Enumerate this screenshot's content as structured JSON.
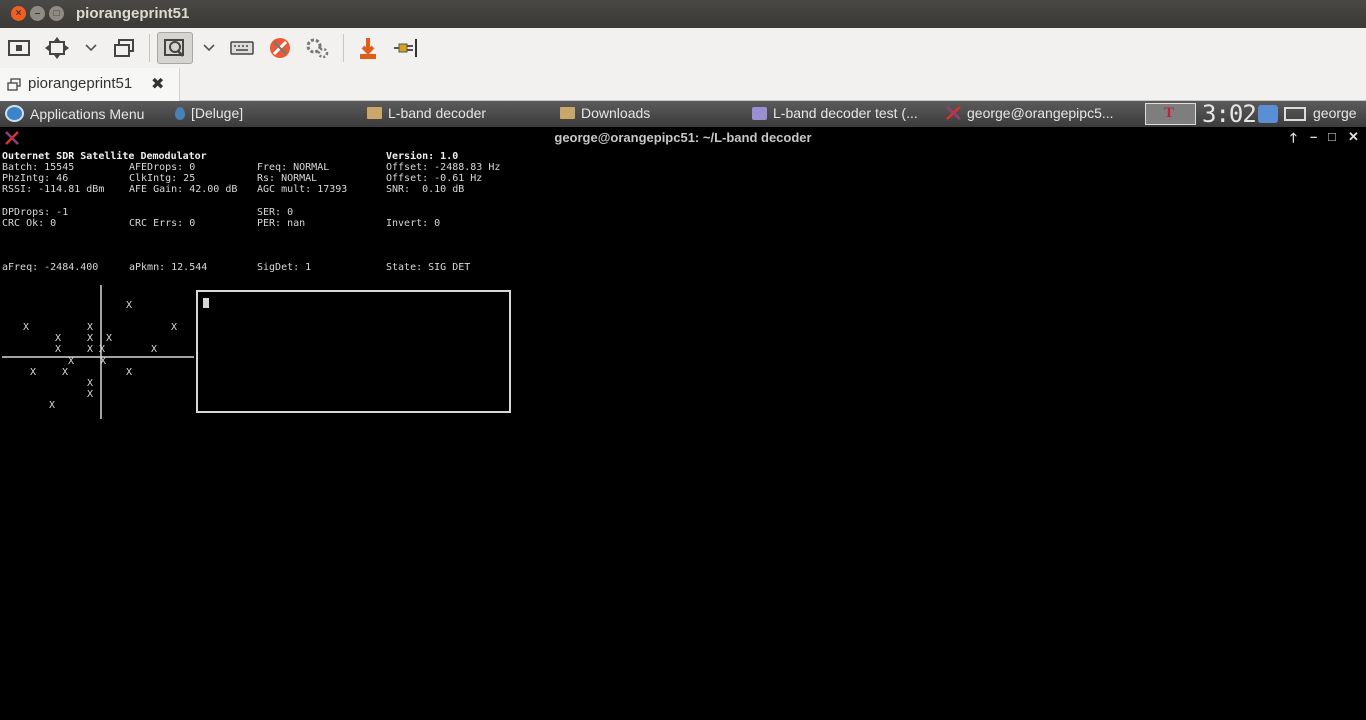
{
  "window": {
    "title": "piorangeprint51"
  },
  "toolbar": {
    "icons": [
      "screen-icon",
      "fit-icon",
      "chevron-down-icon",
      "windows-icon",
      "zoom-icon",
      "chevron-down-icon",
      "keyboard-icon",
      "tools-icon",
      "gear-icon",
      "download-icon",
      "plug-icon"
    ]
  },
  "tab": {
    "label": "piorangeprint51",
    "close": "✖"
  },
  "panel": {
    "apps": "Applications Menu",
    "items": [
      "[Deluge]",
      "L-band decoder",
      "Downloads",
      "L-band decoder test (...",
      "george@orangepipc5..."
    ],
    "clock": "3:02",
    "user": "george"
  },
  "terminal": {
    "title": "george@orangepipc51: ~/L-band decoder",
    "app_title": "Outernet SDR Satellite Demodulator",
    "version": "Version: 1.0",
    "rows": [
      [
        "Batch: 15545",
        "AFEDrops: 0",
        "Freq: NORMAL",
        "Offset: -2488.83 Hz"
      ],
      [
        "PhzIntg: 46",
        "ClkIntg: 25",
        "Rs: NORMAL",
        "Offset: -0.61 Hz"
      ],
      [
        "RSSI: -114.81 dBm",
        "AFE Gain: 42.00 dB",
        "AGC mult: 17393",
        "SNR:  0.10 dB"
      ],
      [
        "",
        "",
        "",
        ""
      ],
      [
        "DPDrops: -1",
        "",
        "SER: 0",
        ""
      ],
      [
        "CRC Ok: 0",
        "CRC Errs: 0",
        "PER: nan",
        "Invert: 0"
      ],
      [
        "",
        "",
        "",
        ""
      ],
      [
        "",
        "",
        "",
        ""
      ],
      [
        "",
        "",
        "",
        ""
      ],
      [
        "aFreq: -2484.400",
        "aPkmn: 12.544",
        "SigDet: 1",
        "State: SIG DET"
      ]
    ],
    "marker": "X"
  }
}
